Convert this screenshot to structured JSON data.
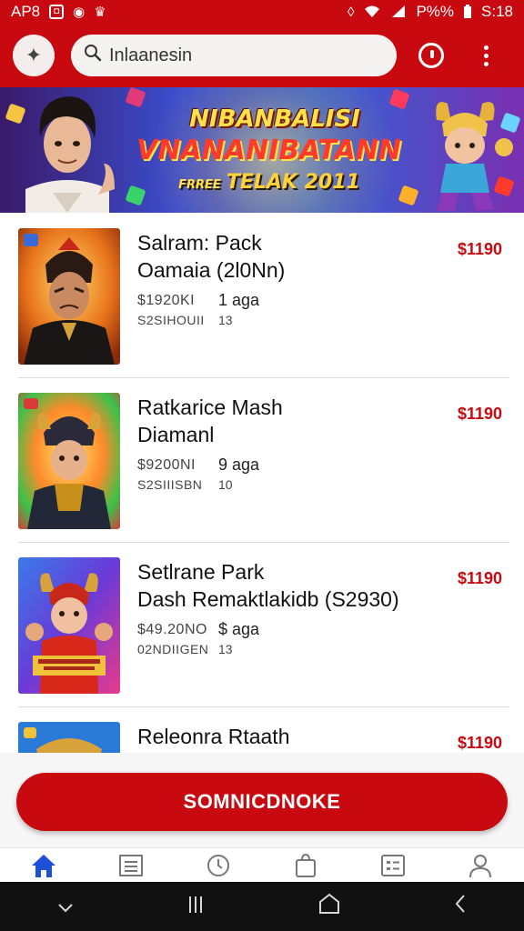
{
  "status_bar": {
    "left_text": "AP8",
    "battery": "P%%",
    "time": "S:18"
  },
  "header": {
    "search_value": "Inlaanesin"
  },
  "banner": {
    "line1": "NIBANBALISI",
    "line2": "VNANANIBATANN",
    "line3_small": "FRREE",
    "line3": "TELAK 2011"
  },
  "items": [
    {
      "name_line1": "Salram: Pack",
      "name_line2": "Oamaia (2l0Nn)",
      "meta1": "$1920KI",
      "meta2": "S2SIHOUII",
      "ago": "1 aga",
      "ago_sub": "13",
      "price": "$1190"
    },
    {
      "name_line1": "Ratkarice Mash",
      "name_line2": "Diamanl",
      "meta1": "$9200NI",
      "meta2": "S2SIIISBN",
      "ago": "9 aga",
      "ago_sub": "10",
      "price": "$1190"
    },
    {
      "name_line1": "Setlrane Park",
      "name_line2": "Dash Remaktlakidb (S2930)",
      "meta1": "$49.20NO",
      "meta2": "02NDIIGEN",
      "ago": "$ aga",
      "ago_sub": "13",
      "price": "$1190"
    },
    {
      "name_line1": "Releonra Rtaath",
      "name_line2": "",
      "meta1": "",
      "meta2": "",
      "ago": "",
      "ago_sub": "",
      "price": "$1190"
    }
  ],
  "cta": {
    "label": "SOMNICDNOKE"
  },
  "bottom_nav": [
    "home-icon",
    "list-icon",
    "clock-icon",
    "bag-icon",
    "card-icon",
    "profile-icon"
  ],
  "colors": {
    "brand_red": "#c80a10",
    "nav_active": "#1d4fd8"
  }
}
